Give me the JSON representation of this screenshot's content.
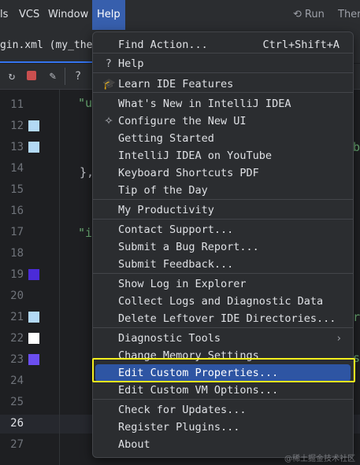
{
  "menubar": {
    "items": [
      "ls",
      "VCS",
      "Window",
      "Help"
    ],
    "run_label": "Run",
    "themes_label": "Them"
  },
  "tabs": {
    "active_label": "gin.xml (my_the"
  },
  "toolbar": {
    "help_label": "?"
  },
  "editor": {
    "line_numbers": [
      "11",
      "12",
      "13",
      "14",
      "15",
      "16",
      "17",
      "18",
      "19",
      "20",
      "21",
      "22",
      "23",
      "24",
      "25",
      "26",
      "27"
    ],
    "current_line": "26",
    "swatches": [
      {
        "line": "12",
        "color": "#b3d9f5"
      },
      {
        "line": "13",
        "color": "#b3d9f5"
      },
      {
        "line": "19",
        "color": "#4b2bd8"
      },
      {
        "line": "21",
        "color": "#b3d9f5"
      },
      {
        "line": "22",
        "color": "#ffffff"
      },
      {
        "line": "23",
        "color": "#6b4ef0"
      }
    ],
    "code": {
      "line11": "\"u",
      "line14": "},",
      "line16": "\"i",
      "line13_tail": "b",
      "line21_tail": "r",
      "line23_tail": "s"
    }
  },
  "help_menu": {
    "items": [
      {
        "label": "Find Action...",
        "shortcut": "Ctrl+Shift+A"
      },
      {
        "label": "Help",
        "icon": "question-icon",
        "icon_glyph": "?"
      },
      {
        "label": "Learn IDE Features",
        "icon": "graduation-cap-icon",
        "icon_glyph": "🎓"
      },
      {
        "label": "What's New in IntelliJ IDEA"
      },
      {
        "label": "Configure the New UI",
        "icon": "sparkle-icon",
        "icon_glyph": "✧"
      },
      {
        "label": "Getting Started"
      },
      {
        "label": "IntelliJ IDEA on YouTube"
      },
      {
        "label": "Keyboard Shortcuts PDF"
      },
      {
        "label": "Tip of the Day"
      },
      {
        "label": "My Productivity"
      },
      {
        "label": "Contact Support..."
      },
      {
        "label": "Submit a Bug Report..."
      },
      {
        "label": "Submit Feedback..."
      },
      {
        "label": "Show Log in Explorer"
      },
      {
        "label": "Collect Logs and Diagnostic Data"
      },
      {
        "label": "Delete Leftover IDE Directories..."
      },
      {
        "label": "Diagnostic Tools",
        "arrow": "›"
      },
      {
        "label": "Change Memory Settings"
      },
      {
        "label": "Edit Custom Properties...",
        "selected": true
      },
      {
        "label": "Edit Custom VM Options..."
      },
      {
        "label": "Check for Updates..."
      },
      {
        "label": "Register Plugins..."
      },
      {
        "label": "About"
      }
    ]
  },
  "colors": {
    "menu_bg": "#2b2d30",
    "selection": "#2e55a3",
    "active_menu": "#375fad",
    "annotation_box": "#f5ef1d",
    "editor_bg": "#1e1f22"
  },
  "watermark": "@稀土掘金技术社区"
}
